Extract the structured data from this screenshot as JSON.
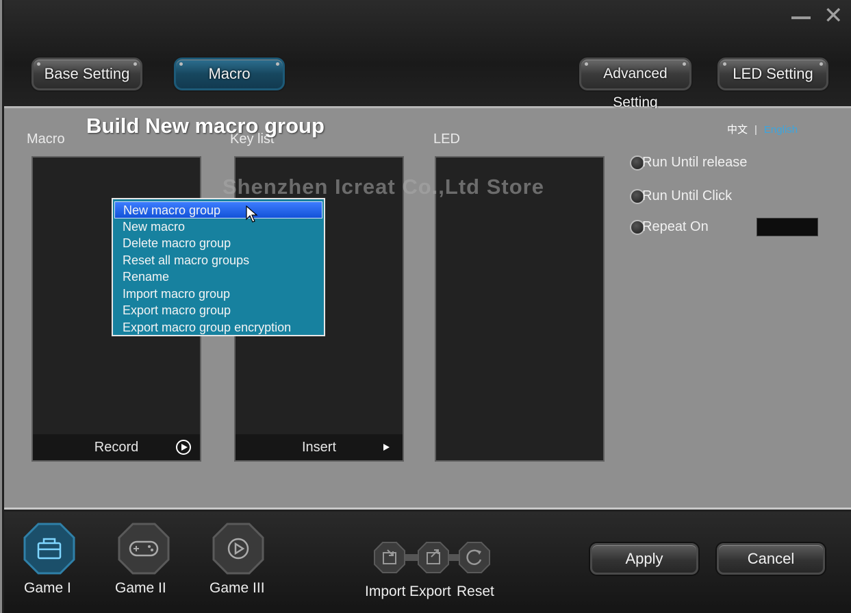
{
  "header": {
    "tabs": [
      {
        "label": "Base Setting",
        "active": false
      },
      {
        "label": "Macro",
        "active": true
      },
      {
        "label": "Advanced Setting",
        "active": false
      },
      {
        "label": "LED Setting",
        "active": false
      }
    ]
  },
  "overlay_title": "Build New macro group",
  "language": {
    "zh": "中文",
    "separator": "|",
    "en": "English",
    "active": "English"
  },
  "columns": {
    "macro": {
      "label": "Macro",
      "footer": "Record"
    },
    "keylist": {
      "label": "Key list",
      "footer": "Insert"
    },
    "led": {
      "label": "LED"
    }
  },
  "context_menu": {
    "items": [
      "New macro group",
      "New macro",
      "Delete macro group",
      "Reset all macro groups",
      "Rename",
      "Import macro group",
      "Export macro group",
      "Export macro group encryption"
    ],
    "highlighted": "New macro group"
  },
  "options": {
    "run_until_release": "Run Until release",
    "run_until_click": "Run Until Click",
    "repeat_on": "Repeat On"
  },
  "watermark": "Shenzhen Icreat Co.,Ltd Store",
  "bottom": {
    "games": [
      {
        "label": "Game I",
        "icon": "toolbox-icon",
        "active": true
      },
      {
        "label": "Game II",
        "icon": "gamepad-icon",
        "active": false
      },
      {
        "label": "Game III",
        "icon": "play-icon",
        "active": false
      }
    ],
    "io": {
      "import": "Import",
      "export": "Export",
      "reset": "Reset"
    },
    "apply": "Apply",
    "cancel": "Cancel"
  },
  "colors": {
    "accent": "#17819f",
    "active_tab": "#1d5a78",
    "english_link": "#3aa6e0"
  }
}
